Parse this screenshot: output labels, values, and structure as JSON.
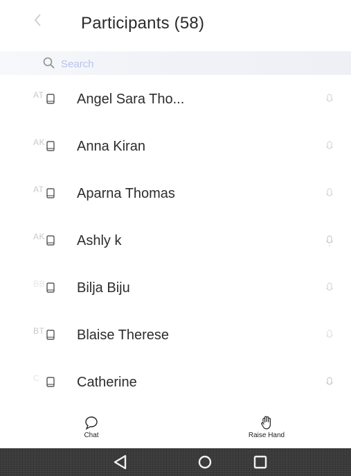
{
  "header": {
    "back_icon": "chevron-left-icon",
    "title": "Participants (58)"
  },
  "search": {
    "icon": "search-icon",
    "placeholder": "Search"
  },
  "participants": [
    {
      "initials": "AT",
      "name": "Angel Sara Tho..."
    },
    {
      "initials": "AK",
      "name": "Anna Kiran"
    },
    {
      "initials": "AT",
      "name": "Aparna Thomas"
    },
    {
      "initials": "AK",
      "name": "Ashly k"
    },
    {
      "initials": "BB",
      "name": "Bilja Biju"
    },
    {
      "initials": "BT",
      "name": "Blaise Therese"
    },
    {
      "initials": "C",
      "name": "Catherine"
    }
  ],
  "toolbar": {
    "chat_label": "Chat",
    "raise_hand_label": "Raise Hand"
  },
  "colors": {
    "text": "#2c2c2c",
    "muted": "#c8c8c8",
    "search_placeholder": "#b7c3ea",
    "navbar": "#3a3a3a"
  }
}
